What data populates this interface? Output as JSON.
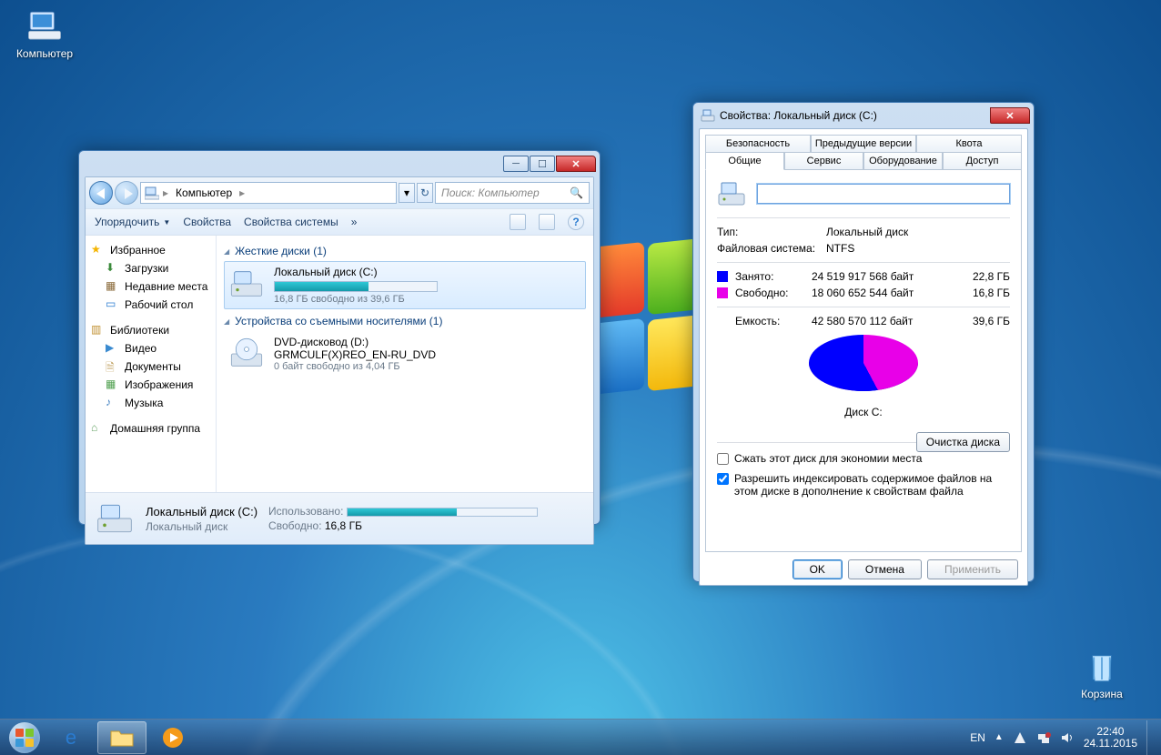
{
  "desktop": {
    "computer": "Компьютер",
    "recycle": "Корзина"
  },
  "explorer": {
    "breadcrumb": "Компьютер",
    "search_placeholder": "Поиск: Компьютер",
    "toolbar": {
      "organize": "Упорядочить",
      "properties": "Свойства",
      "system_properties": "Свойства системы"
    },
    "nav": {
      "favorites": "Избранное",
      "downloads": "Загрузки",
      "recent": "Недавние места",
      "desktop": "Рабочий стол",
      "libraries": "Библиотеки",
      "video": "Видео",
      "documents": "Документы",
      "pictures": "Изображения",
      "music": "Музыка",
      "homegroup": "Домашняя группа"
    },
    "groups": {
      "hdd": "Жесткие диски (1)",
      "removable": "Устройства со съемными носителями (1)"
    },
    "drive_c": {
      "name": "Локальный диск (C:)",
      "sub": "16,8 ГБ свободно из 39,6 ГБ",
      "fill_pct": 58
    },
    "drive_d": {
      "name": "DVD-дисковод (D:)",
      "label": "GRMCULF(X)REO_EN-RU_DVD",
      "sub": "0 байт свободно из 4,04 ГБ"
    },
    "status": {
      "title": "Локальный диск (C:)",
      "type": "Локальный диск",
      "used_k": "Использовано:",
      "free_k": "Свободно:",
      "free_v": "16,8 ГБ",
      "fill_pct": 58
    }
  },
  "props": {
    "title": "Свойства: Локальный диск (C:)",
    "tabs_row1": [
      "Безопасность",
      "Предыдущие версии",
      "Квота"
    ],
    "tabs_row2": [
      "Общие",
      "Сервис",
      "Оборудование",
      "Доступ"
    ],
    "active_tab": "Общие",
    "label_value": "",
    "type_k": "Тип:",
    "type_v": "Локальный диск",
    "fs_k": "Файловая система:",
    "fs_v": "NTFS",
    "used_k": "Занято:",
    "used_bytes": "24 519 917 568 байт",
    "used_gb": "22,8 ГБ",
    "free_k": "Свободно:",
    "free_bytes": "18 060 652 544 байт",
    "free_gb": "16,8 ГБ",
    "cap_k": "Емкость:",
    "cap_bytes": "42 580 570 112 байт",
    "cap_gb": "39,6 ГБ",
    "disk_label": "Диск C:",
    "cleanup": "Очистка диска",
    "compress": "Сжать этот диск для экономии места",
    "index": "Разрешить индексировать содержимое файлов на этом диске в дополнение к свойствам файла",
    "ok": "OK",
    "cancel": "Отмена",
    "apply": "Применить"
  },
  "taskbar": {
    "lang": "EN",
    "time": "22:40",
    "date": "24.11.2015"
  },
  "chart_data": {
    "type": "pie",
    "title": "Диск C:",
    "series": [
      {
        "name": "Занято",
        "value_bytes": 24519917568,
        "value_gb": 22.8,
        "color": "#0000ff"
      },
      {
        "name": "Свободно",
        "value_bytes": 18060652544,
        "value_gb": 16.8,
        "color": "#e800e8"
      }
    ],
    "total_bytes": 42580570112,
    "total_gb": 39.6
  }
}
